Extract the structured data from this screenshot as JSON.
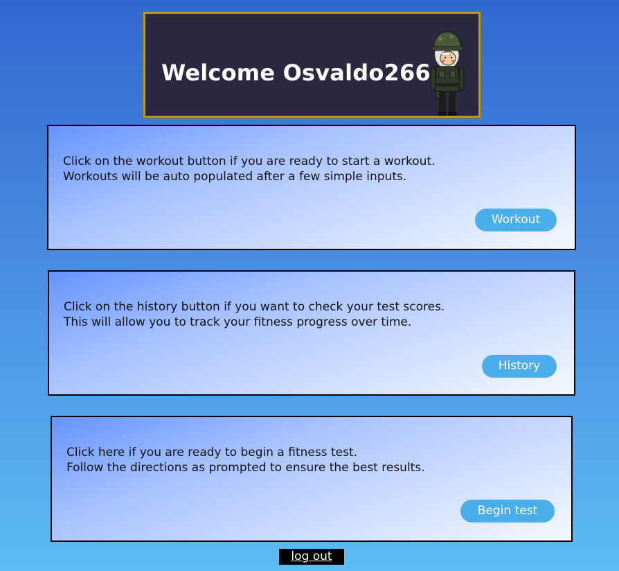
{
  "banner": {
    "title": "Welcome Osvaldo266",
    "avatar_icon": "soldier-avatar"
  },
  "cards": [
    {
      "line1": "Click on the workout button if you are ready to start a workout.",
      "line2": "Workouts will be auto populated after a few simple inputs.",
      "button_label": "Workout"
    },
    {
      "line1": "Click on the history button if you want to check your test scores.",
      "line2": "This will allow you to track your fitness progress over time.",
      "button_label": "History"
    },
    {
      "line1": "Click here if you are ready to begin a fitness test.",
      "line2": "Follow the directions as prompted to ensure the best results.",
      "button_label": "Begin test"
    }
  ],
  "footer": {
    "logout_label": "log out"
  },
  "colors": {
    "banner_bg": "#2b2940",
    "banner_border": "#b89a1c",
    "button_bg": "#4aaeea",
    "page_gradient_top": "#3168d0",
    "page_gradient_bottom": "#5cbcf3"
  }
}
